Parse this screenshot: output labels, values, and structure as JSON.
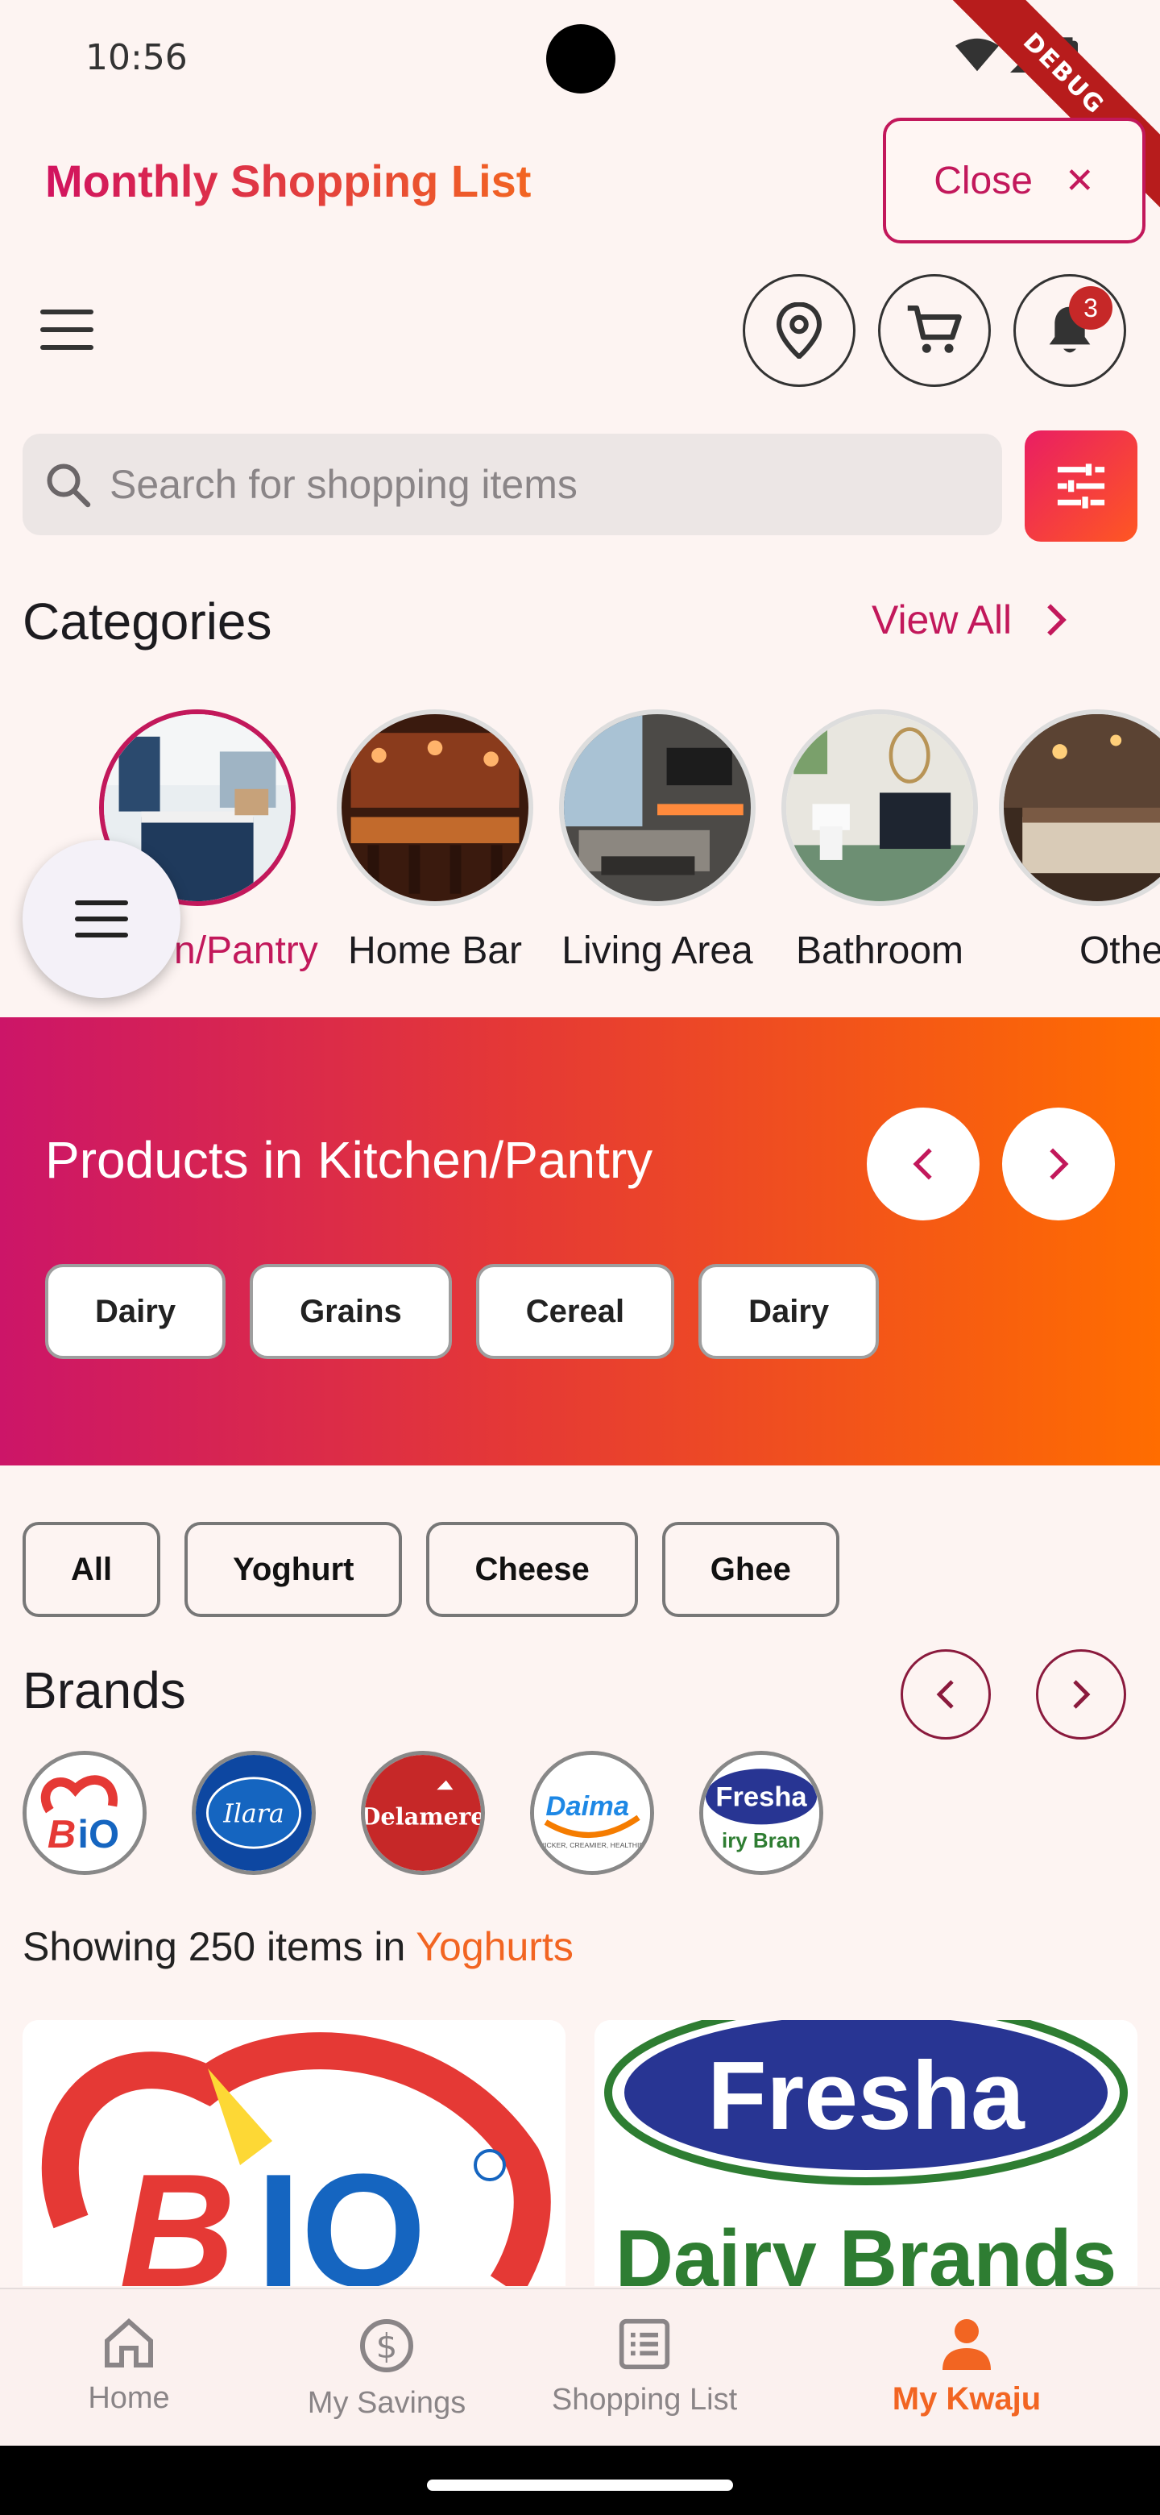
{
  "status_bar": {
    "time": "10:56",
    "debug_label": "DEBUG"
  },
  "header": {
    "title": "Monthly Shopping List",
    "close_label": "Close",
    "close_icon": "close-icon"
  },
  "toolbar": {
    "menu_icon": "menu-icon",
    "location_icon": "location-pin-icon",
    "cart_icon": "cart-icon",
    "bell_icon": "bell-icon",
    "notification_count": "3"
  },
  "search": {
    "placeholder": "Search for shopping items",
    "filter_icon": "tune-icon"
  },
  "categories": {
    "title": "Categories",
    "view_all": "View All",
    "items": [
      {
        "label": "Kitchen/Pantry",
        "visible_label": "n/Pantry",
        "active": true
      },
      {
        "label": "Home Bar"
      },
      {
        "label": "Living Area"
      },
      {
        "label": "Bathroom"
      },
      {
        "label": "Other",
        "visible_label": "Othe"
      }
    ]
  },
  "banner": {
    "title": "Products in Kitchen/Pantry",
    "chips": [
      "Dairy",
      "Grains",
      "Cereal",
      "Dairy"
    ],
    "gradient": [
      "#cc1568",
      "#ff6d00"
    ]
  },
  "filters": [
    "All",
    "Yoghurt",
    "Cheese",
    "Ghee"
  ],
  "brands": {
    "title": "Brands",
    "items": [
      {
        "name": "Bio"
      },
      {
        "name": "Ilara"
      },
      {
        "name": "Delamere"
      },
      {
        "name": "Daima",
        "tagline": "THICKER, CREAMIER, HEALTHIER"
      },
      {
        "name": "Fresha",
        "visible_sub": "iry Bran"
      }
    ]
  },
  "results": {
    "prefix": "Showing 250 items in",
    "category": "Yoghurts"
  },
  "products": [
    {
      "brand": "Bio"
    },
    {
      "brand": "Fresha",
      "sub": "Dairy Brands"
    }
  ],
  "bottom_nav": [
    {
      "label": "Home",
      "icon": "home-icon"
    },
    {
      "label": "My Savings",
      "icon": "dollar-circle-icon"
    },
    {
      "label": "Shopping List",
      "icon": "list-icon"
    },
    {
      "label": "My Kwaju",
      "icon": "person-icon",
      "active": true
    }
  ],
  "colors": {
    "primary": "#c2185b",
    "accent": "#f26522",
    "background": "#fdf4f2"
  }
}
